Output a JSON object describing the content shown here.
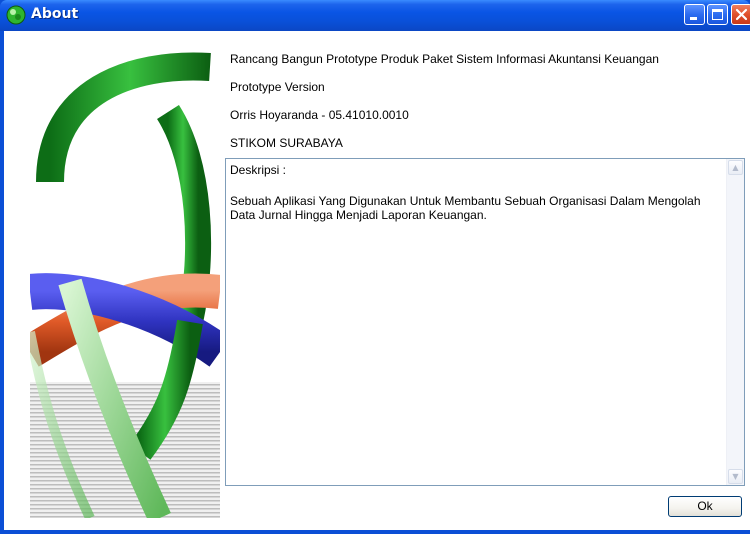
{
  "window": {
    "title": "About"
  },
  "info": {
    "app_name": "Rancang Bangun Prototype Produk Paket Sistem Informasi Akuntansi Keuangan",
    "version": "Prototype Version",
    "author": "Orris Hoyaranda - 05.41010.0010",
    "institution": "STIKOM SURABAYA"
  },
  "description": {
    "heading": "Deskripsi :",
    "body": "Sebuah Aplikasi Yang Digunakan Untuk Membantu Sebuah Organisasi Dalam Mengolah Data Jurnal Hingga Menjadi Laporan Keuangan."
  },
  "buttons": {
    "ok_label": "Ok"
  },
  "icons": {
    "app": "green-globe-icon",
    "minimize": "minimize-icon",
    "maximize": "maximize-icon",
    "close": "close-icon",
    "scroll_up": "scroll-up-arrow-icon",
    "scroll_down": "scroll-down-arrow-icon"
  },
  "colors": {
    "titlebar": "#0a55e5",
    "frame": "#0b4fd6",
    "ring_green": "#1f9e2a",
    "ring_blue": "#3236c6",
    "ring_orange": "#e05a28"
  }
}
